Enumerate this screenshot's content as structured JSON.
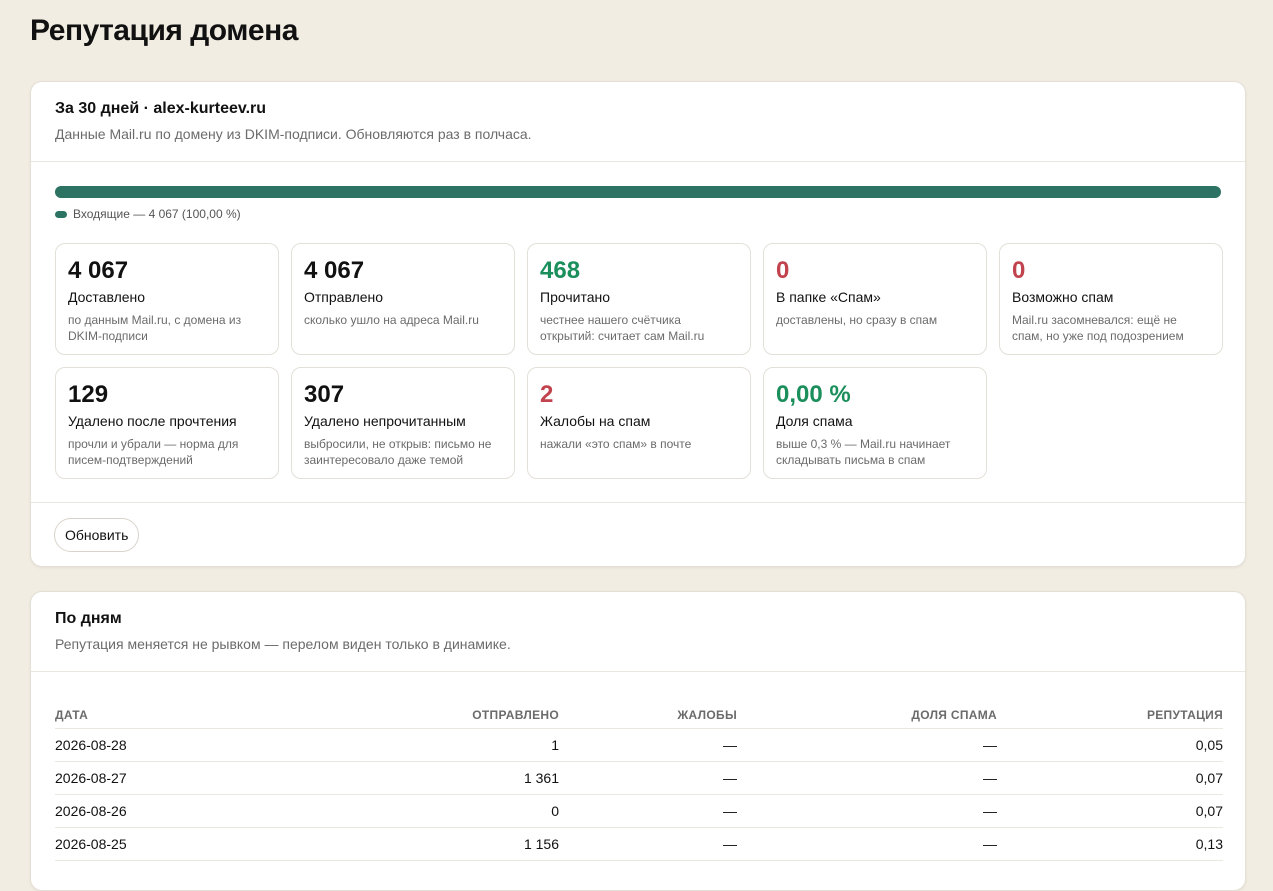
{
  "page_title": "Репутация домена",
  "summary": {
    "title": "За 30 дней · alex-kurteev.ru",
    "subtitle": "Данные Mail.ru по домену из DKIM-подписи. Обновляются раз в полчаса.",
    "bar": {
      "fraction": 1.0,
      "color": "#2d7364"
    },
    "legend": "Входящие — 4 067 (100,00 %)",
    "stats": [
      {
        "value": "4 067",
        "label": "Доставлено",
        "desc": "по данным Mail.ru, с домена из DKIM-подписи",
        "tone": "normal"
      },
      {
        "value": "4 067",
        "label": "Отправлено",
        "desc": "сколько ушло на адреса Mail.ru",
        "tone": "normal"
      },
      {
        "value": "468",
        "label": "Прочитано",
        "desc": "честнее нашего счётчика открытий: считает сам Mail.ru",
        "tone": "green"
      },
      {
        "value": "0",
        "label": "В папке «Спам»",
        "desc": "доставлены, но сразу в спам",
        "tone": "red"
      },
      {
        "value": "0",
        "label": "Возможно спам",
        "desc": "Mail.ru засомневался: ещё не спам, но уже под подозрением",
        "tone": "red"
      },
      {
        "value": "129",
        "label": "Удалено после прочтения",
        "desc": "прочли и убрали — норма для писем-подтверждений",
        "tone": "normal"
      },
      {
        "value": "307",
        "label": "Удалено непрочитанным",
        "desc": "выбросили, не открыв: письмо не заинтересовало даже темой",
        "tone": "normal"
      },
      {
        "value": "2",
        "label": "Жалобы на спам",
        "desc": "нажали «это спам» в почте",
        "tone": "red"
      },
      {
        "value": "0,00 %",
        "label": "Доля спама",
        "desc": "выше 0,3 % — Mail.ru начинает складывать письма в спам",
        "tone": "green"
      }
    ],
    "refresh_label": "Обновить"
  },
  "daily": {
    "title": "По дням",
    "subtitle": "Репутация меняется не рывком — перелом виден только в динамике.",
    "columns": [
      "Дата",
      "Отправлено",
      "Жалобы",
      "Доля спама",
      "Репутация"
    ],
    "rows": [
      [
        "2026-08-28",
        "1",
        "—",
        "—",
        "0,05"
      ],
      [
        "2026-08-27",
        "1 361",
        "—",
        "—",
        "0,07"
      ],
      [
        "2026-08-26",
        "0",
        "—",
        "—",
        "0,07"
      ],
      [
        "2026-08-25",
        "1 156",
        "—",
        "—",
        "0,13"
      ]
    ]
  }
}
